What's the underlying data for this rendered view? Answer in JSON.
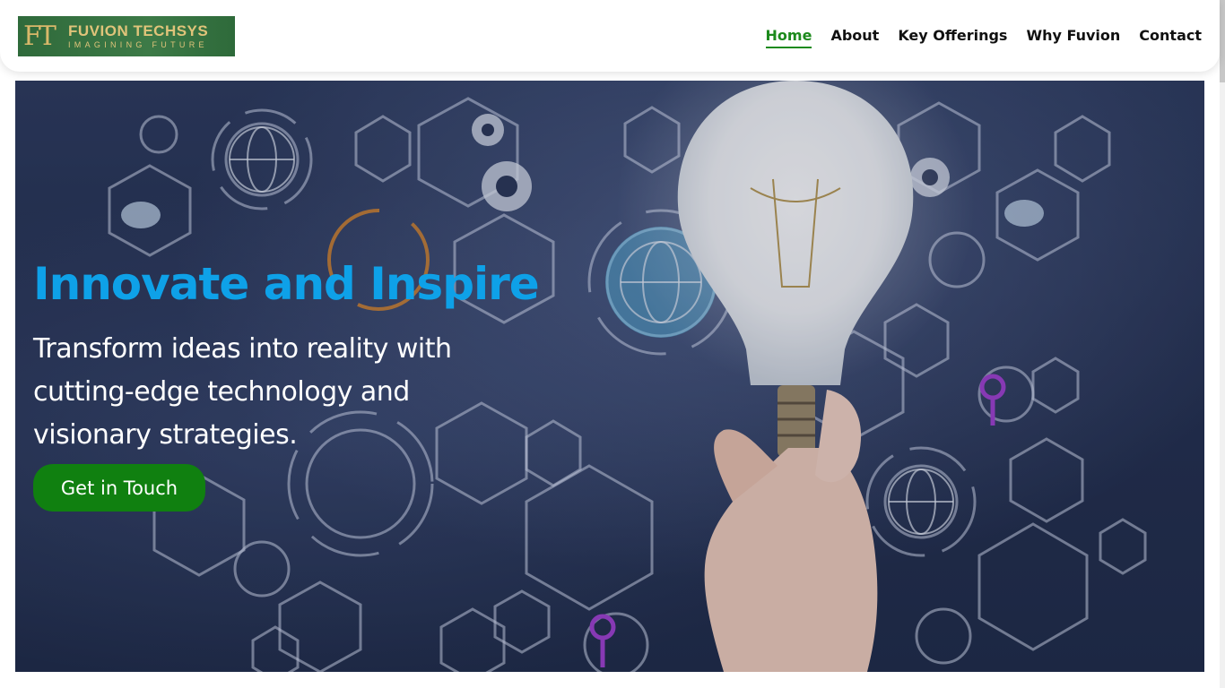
{
  "brand": {
    "logo_mark": "FT",
    "name": "FUVION TECHSYS",
    "tagline": "IMAGINING FUTURE"
  },
  "nav": {
    "items": [
      {
        "label": "Home",
        "active": true
      },
      {
        "label": "About",
        "active": false
      },
      {
        "label": "Key Offerings",
        "active": false
      },
      {
        "label": "Why Fuvion",
        "active": false
      },
      {
        "label": "Contact",
        "active": false
      }
    ]
  },
  "hero": {
    "title": "Innovate and Inspire",
    "subtitle": "Transform ideas into reality with cutting-edge technology and visionary strategies.",
    "cta_label": "Get in Touch",
    "image_subject": "hand-holding-lightbulb-tech-icons"
  },
  "colors": {
    "accent_green": "#108010",
    "nav_active": "#1d8a1d",
    "title_blue": "#0ea1e8",
    "logo_bg": "#2f6a3b",
    "logo_gold": "#e0c47a"
  }
}
